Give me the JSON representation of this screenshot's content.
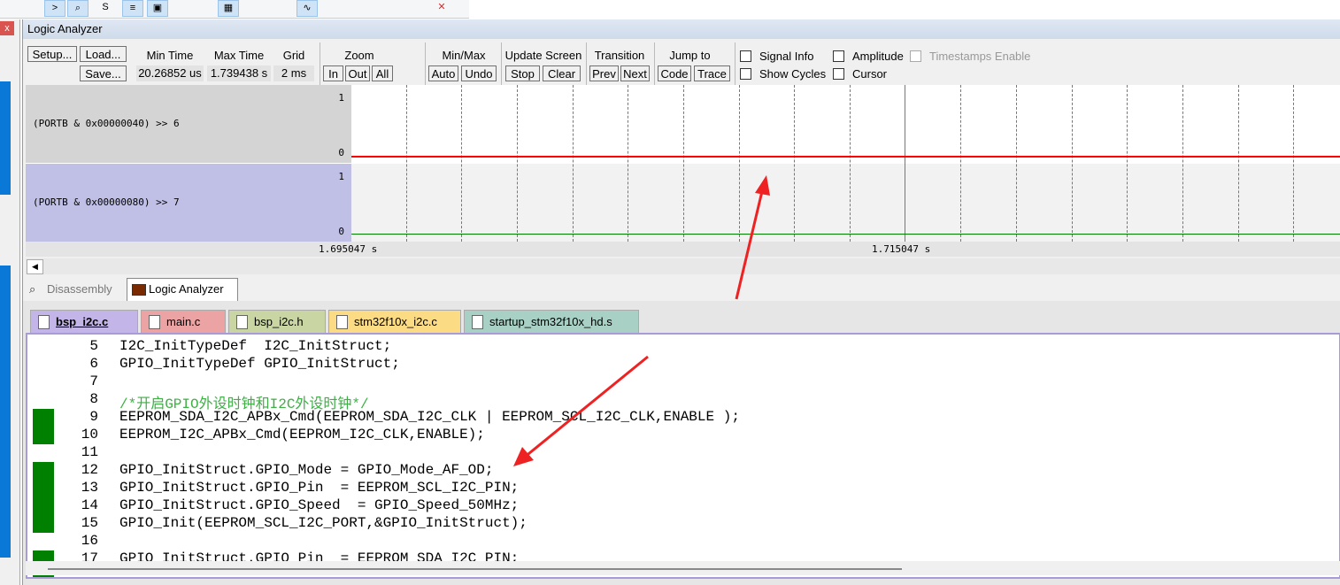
{
  "window": {
    "title": "Logic Analyzer"
  },
  "controls": {
    "setup": "Setup...",
    "load": "Load...",
    "save": "Save...",
    "min_time_label": "Min Time",
    "min_time": "20.26852 us",
    "max_time_label": "Max Time",
    "max_time": "1.739438 s",
    "grid_label": "Grid",
    "grid": "2 ms",
    "zoom_label": "Zoom",
    "zoom_in": "In",
    "zoom_out": "Out",
    "zoom_all": "All",
    "minmax_label": "Min/Max",
    "auto": "Auto",
    "undo": "Undo",
    "update_label": "Update Screen",
    "stop": "Stop",
    "clear": "Clear",
    "transition_label": "Transition",
    "prev": "Prev",
    "next": "Next",
    "jump_label": "Jump to",
    "code": "Code",
    "trace": "Trace",
    "signal_info": "Signal Info",
    "show_cycles": "Show Cycles",
    "amplitude": "Amplitude",
    "cursor": "Cursor",
    "timestamps": "Timestamps Enable"
  },
  "signals": [
    {
      "name": "(PORTB & 0x00000040) >> 6",
      "max": "1",
      "min": "0",
      "value": 0,
      "color": "#ff0000"
    },
    {
      "name": "(PORTB & 0x00000080) >> 7",
      "max": "1",
      "min": "0",
      "value": 0,
      "color": "#008000"
    }
  ],
  "time_axis": [
    "1.695047 s",
    "1.715047 s"
  ],
  "bottom_tabs": [
    "Disassembly",
    "Logic Analyzer"
  ],
  "file_tabs": [
    {
      "label": "bsp_i2c.c",
      "color": "#c3b5e8"
    },
    {
      "label": "main.c",
      "color": "#eba3a3"
    },
    {
      "label": "bsp_i2c.h",
      "color": "#c9d6a4"
    },
    {
      "label": "stm32f10x_i2c.c",
      "color": "#fbdc85"
    },
    {
      "label": "startup_stm32f10x_hd.s",
      "color": "#a8d0c4"
    }
  ],
  "code": [
    {
      "n": "5",
      "t": "I2C_InitTypeDef  I2C_InitStruct;"
    },
    {
      "n": "6",
      "t": "GPIO_InitTypeDef GPIO_InitStruct;"
    },
    {
      "n": "7",
      "t": ""
    },
    {
      "n": "8",
      "t": "/*开启GPIO外设时钟和I2C外设时钟*/"
    },
    {
      "n": "9",
      "t": "EEPROM_SDA_I2C_APBx_Cmd(EEPROM_SDA_I2C_CLK | EEPROM_SCL_I2C_CLK,ENABLE );"
    },
    {
      "n": "10",
      "t": "EEPROM_I2C_APBx_Cmd(EEPROM_I2C_CLK,ENABLE);"
    },
    {
      "n": "11",
      "t": ""
    },
    {
      "n": "12",
      "t": "GPIO_InitStruct.GPIO_Mode = GPIO_Mode_AF_OD;"
    },
    {
      "n": "13",
      "t": "GPIO_InitStruct.GPIO_Pin  = EEPROM_SCL_I2C_PIN;"
    },
    {
      "n": "14",
      "t": "GPIO_InitStruct.GPIO_Speed  = GPIO_Speed_50MHz;"
    },
    {
      "n": "15",
      "t": "GPIO_Init(EEPROM_SCL_I2C_PORT,&GPIO_InitStruct);"
    },
    {
      "n": "16",
      "t": ""
    },
    {
      "n": "17",
      "t": "GPIO_InitStruct.GPIO_Pin  = EEPROM_SDA_I2C_PIN;"
    }
  ]
}
